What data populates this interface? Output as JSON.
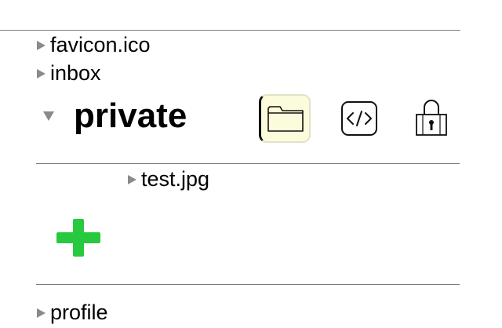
{
  "tree": {
    "items": [
      {
        "label": "favicon.ico"
      },
      {
        "label": "inbox"
      },
      {
        "label": "private"
      },
      {
        "label": "test.jpg"
      },
      {
        "label": "profile"
      }
    ]
  },
  "toolbar": {
    "icons": [
      "folder-icon",
      "code-icon",
      "lock-icon",
      "plus-icon"
    ]
  },
  "colors": {
    "accent_add": "#27c93f",
    "folder_button_bg": "#fcfcdc",
    "divider": "#7a7a7a",
    "triangle": "#8a8a8a"
  }
}
